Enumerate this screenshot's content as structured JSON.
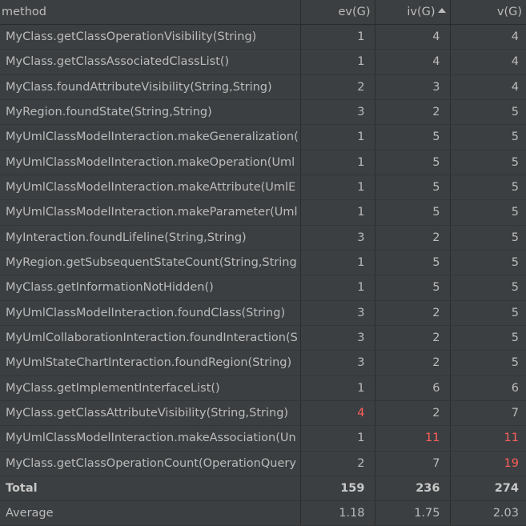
{
  "table": {
    "columns": {
      "method": "method",
      "ev": "ev(G)",
      "iv": "iv(G)",
      "v": "v(G)"
    },
    "sorted_column": "iv(G)",
    "sort_direction": "ascending",
    "highlight_color": "#ff5f5a",
    "rows": [
      {
        "method": "MyClass.getClassOperationVisibility(String)",
        "ev": "1",
        "iv": "4",
        "v": "4"
      },
      {
        "method": "MyClass.getClassAssociatedClassList()",
        "ev": "1",
        "iv": "4",
        "v": "4"
      },
      {
        "method": "MyClass.foundAttributeVisibility(String,String)",
        "ev": "2",
        "iv": "3",
        "v": "4"
      },
      {
        "method": "MyRegion.foundState(String,String)",
        "ev": "3",
        "iv": "2",
        "v": "5"
      },
      {
        "method": "MyUmlClassModelInteraction.makeGeneralization(",
        "ev": "1",
        "iv": "5",
        "v": "5"
      },
      {
        "method": "MyUmlClassModelInteraction.makeOperation(Uml",
        "ev": "1",
        "iv": "5",
        "v": "5"
      },
      {
        "method": "MyUmlClassModelInteraction.makeAttribute(UmlE",
        "ev": "1",
        "iv": "5",
        "v": "5"
      },
      {
        "method": "MyUmlClassModelInteraction.makeParameter(Uml",
        "ev": "1",
        "iv": "5",
        "v": "5"
      },
      {
        "method": "MyInteraction.foundLifeline(String,String)",
        "ev": "3",
        "iv": "2",
        "v": "5"
      },
      {
        "method": "MyRegion.getSubsequentStateCount(String,String",
        "ev": "1",
        "iv": "5",
        "v": "5"
      },
      {
        "method": "MyClass.getInformationNotHidden()",
        "ev": "1",
        "iv": "5",
        "v": "5"
      },
      {
        "method": "MyUmlClassModelInteraction.foundClass(String)",
        "ev": "3",
        "iv": "2",
        "v": "5"
      },
      {
        "method": "MyUmlCollaborationInteraction.foundInteraction(S",
        "ev": "3",
        "iv": "2",
        "v": "5"
      },
      {
        "method": "MyUmlStateChartInteraction.foundRegion(String)",
        "ev": "3",
        "iv": "2",
        "v": "5"
      },
      {
        "method": "MyClass.getImplementInterfaceList()",
        "ev": "1",
        "iv": "6",
        "v": "6"
      },
      {
        "method": "MyClass.getClassAttributeVisibility(String,String)",
        "ev": "4",
        "iv": "2",
        "v": "7",
        "flag_ev": true
      },
      {
        "method": "MyUmlClassModelInteraction.makeAssociation(Un",
        "ev": "1",
        "iv": "11",
        "v": "11",
        "flag_iv": true,
        "flag_v": true
      },
      {
        "method": "MyClass.getClassOperationCount(OperationQuery",
        "ev": "2",
        "iv": "7",
        "v": "19",
        "flag_v": true
      }
    ],
    "total": {
      "label": "Total",
      "ev": "159",
      "iv": "236",
      "v": "274"
    },
    "average": {
      "label": "Average",
      "ev": "1.18",
      "iv": "1.75",
      "v": "2.03"
    }
  }
}
